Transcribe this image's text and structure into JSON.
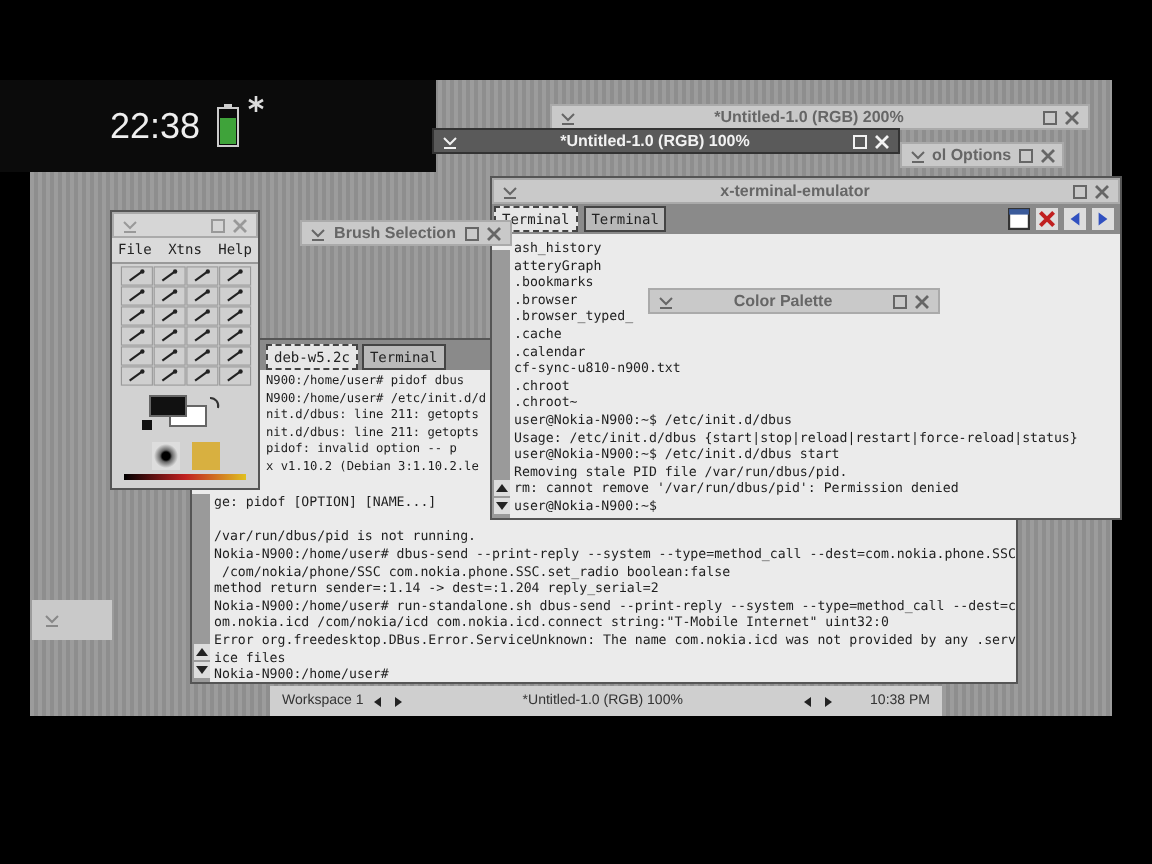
{
  "status_bar": {
    "time": "22:38"
  },
  "terminal_front": {
    "title": "x-terminal-emulator",
    "focused": false,
    "tabs": [
      {
        "label": "Terminal",
        "selected": true
      },
      {
        "label": "Terminal",
        "selected": false
      }
    ],
    "lines": [
      "ash_history",
      "atteryGraph",
      ".bookmarks",
      ".browser",
      ".browser_typed_",
      ".cache",
      ".calendar",
      "cf-sync-u810-n900.txt",
      ".chroot",
      ".chroot~",
      "user@Nokia-N900:~$ /etc/init.d/dbus",
      "Usage: /etc/init.d/dbus {start|stop|reload|restart|force-reload|status}",
      "user@Nokia-N900:~$ /etc/init.d/dbus start",
      "Removing stale PID file /var/run/dbus/pid.",
      "rm: cannot remove '/var/run/dbus/pid': Permission denied",
      "user@Nokia-N900:~$"
    ]
  },
  "terminal_back": {
    "tabs": [
      {
        "label": "deb-w5.2c",
        "selected": true
      },
      {
        "label": "Terminal",
        "selected": false
      }
    ],
    "blocks": [
      [
        "N900:/home/user# pidof dbus",
        "N900:/home/user# /etc/init.d/d",
        "nit.d/dbus: line 211: getopts",
        "nit.d/dbus: line 211: getopts",
        "pidof: invalid option -- p",
        "x v1.10.2 (Debian 3:1.10.2.le"
      ],
      [
        "ge: pidof [OPTION] [NAME...]"
      ],
      [
        "/var/run/dbus/pid is not running.",
        "Nokia-N900:/home/user# dbus-send --print-reply --system --type=method_call --dest=com.nokia.phone.SSC",
        " /com/nokia/phone/SSC com.nokia.phone.SSC.set_radio boolean:false",
        "method return sender=:1.14 -> dest=:1.204 reply_serial=2",
        "Nokia-N900:/home/user# run-standalone.sh dbus-send --print-reply --system --type=method_call --dest=c",
        "om.nokia.icd /com/nokia/icd com.nokia.icd.connect string:\"T-Mobile Internet\" uint32:0",
        "Error org.freedesktop.DBus.Error.ServiceUnknown: The name com.nokia.icd was not provided by any .serv",
        "ice files",
        "Nokia-N900:/home/user#"
      ]
    ]
  },
  "toolbox": {
    "menu": [
      "File",
      "Xtns",
      "Help"
    ]
  },
  "floating_windows": [
    {
      "title": "*Untitled-1.0 (RGB) 200%",
      "focused": false
    },
    {
      "title": "ol Options",
      "focused": false
    },
    {
      "title": "*Untitled-1.0 (RGB) 100%",
      "focused": true
    },
    {
      "title": "Brush Selection",
      "focused": false
    },
    {
      "title": "Color Palette",
      "focused": false
    }
  ],
  "taskbar": {
    "workspace": "Workspace 1",
    "task": "*Untitled-1.0 (RGB) 100%",
    "clock": "10:38 PM"
  }
}
